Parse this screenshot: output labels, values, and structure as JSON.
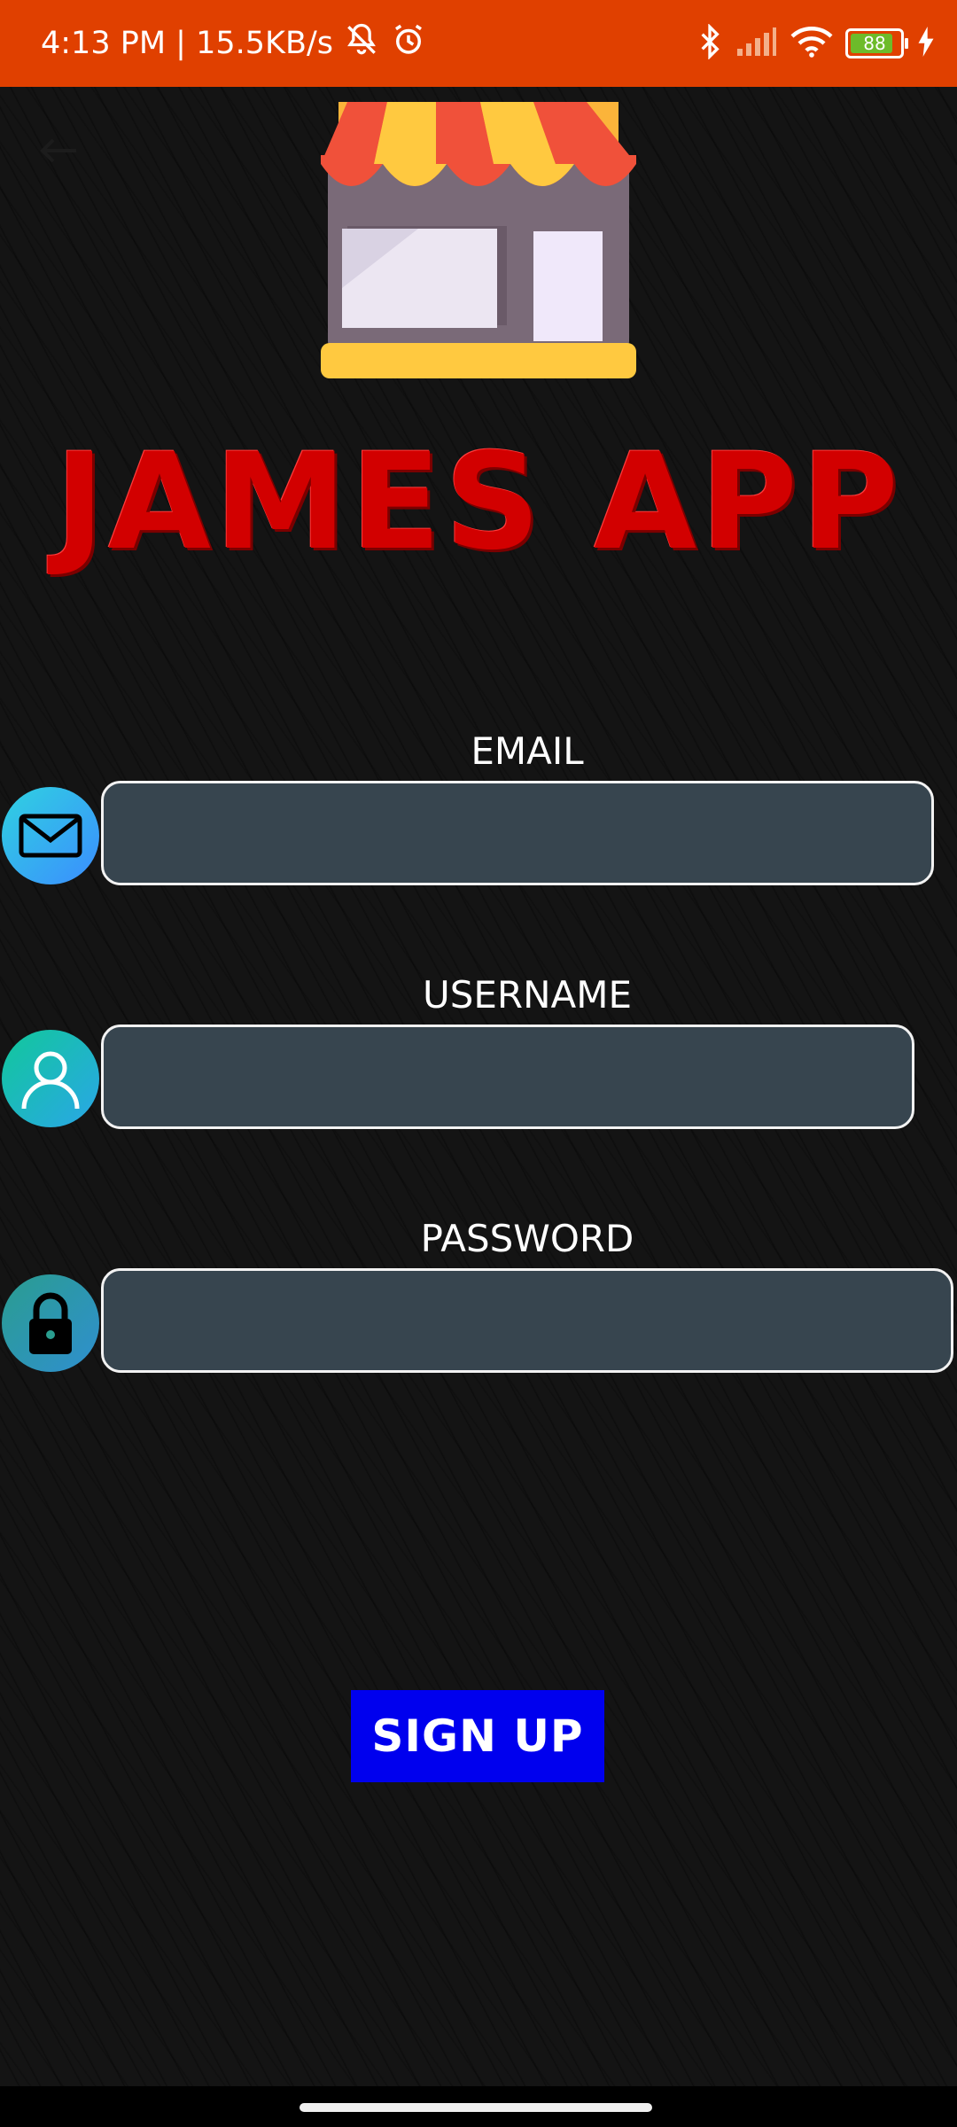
{
  "status_bar": {
    "time_speed": "4:13 PM | 15.5KB/s",
    "battery_level": "88",
    "icons": [
      "mute-bell-icon",
      "alarm-icon",
      "bluetooth-icon",
      "signal-icon",
      "wifi-icon",
      "battery-icon",
      "charging-icon"
    ]
  },
  "header": {
    "title": "JAMES APP",
    "logo_icon": "store-icon"
  },
  "form": {
    "email": {
      "label": "EMAIL",
      "value": "",
      "placeholder": ""
    },
    "username": {
      "label": "USERNAME",
      "value": "",
      "placeholder": ""
    },
    "password": {
      "label": "PASSWORD",
      "value": "",
      "placeholder": ""
    }
  },
  "actions": {
    "signup_label": "SIGN UP"
  },
  "colors": {
    "status_bar": "#e04000",
    "title": "#d20000",
    "button": "#0000ee",
    "input_bg": "#37454f"
  }
}
